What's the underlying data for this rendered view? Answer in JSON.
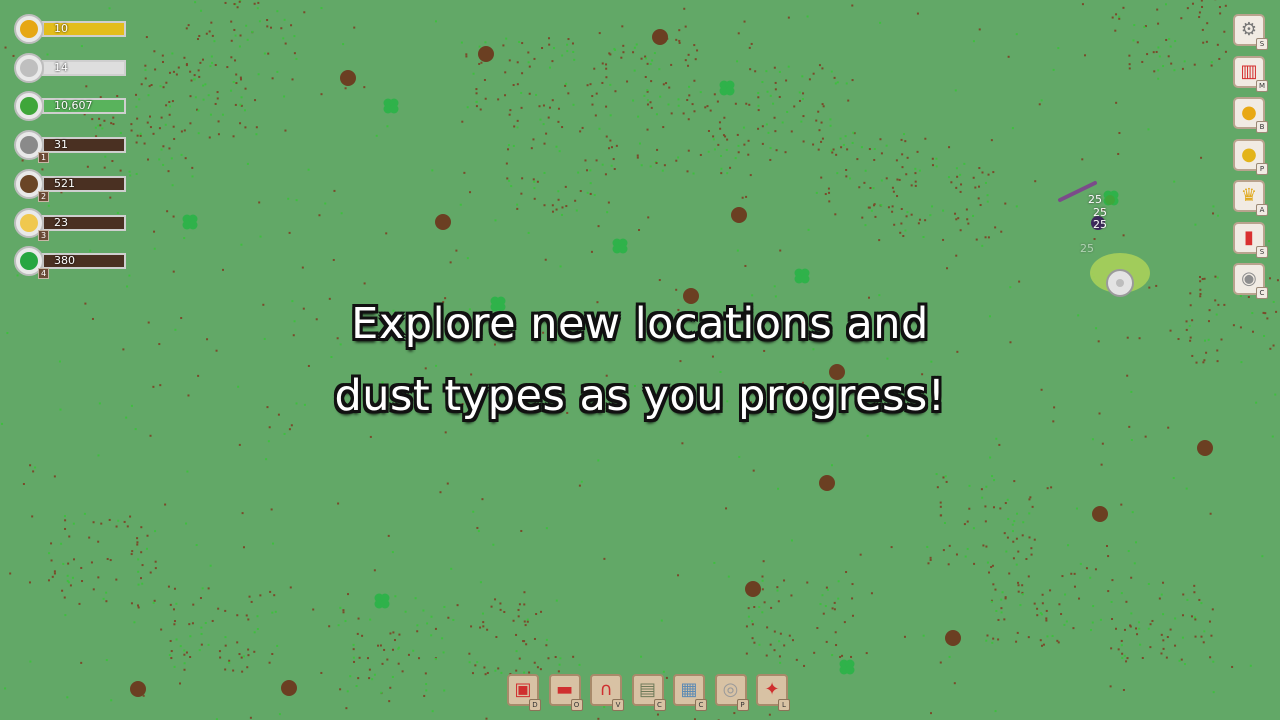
{
  "resources": [
    {
      "name": "gold-coins",
      "value": "10",
      "key": "",
      "fill_ratio": 1.0,
      "fill_color": "#e3bd1c",
      "icon_color": "#e6a714"
    },
    {
      "name": "silver-coins",
      "value": "14",
      "key": "",
      "fill_ratio": 1.0,
      "fill_color": "#dedede",
      "icon_color": "#bfbfbf"
    },
    {
      "name": "cash",
      "value": "10,607",
      "key": "",
      "fill_ratio": 1.0,
      "fill_color": "#59b35c",
      "icon_color": "#3fa63a"
    },
    {
      "name": "gray-dust",
      "value": "31",
      "key": "1",
      "fill_ratio": 0.0,
      "fill_color": "#4a3022",
      "icon_color": "#8a8a8a"
    },
    {
      "name": "brown-dust",
      "value": "521",
      "key": "2",
      "fill_ratio": 0.05,
      "fill_color": "#4a3022",
      "icon_color": "#6a4526"
    },
    {
      "name": "gold-dust",
      "value": "23",
      "key": "3",
      "fill_ratio": 0.0,
      "fill_color": "#4a3022",
      "icon_color": "#f0c84e"
    },
    {
      "name": "clover",
      "value": "380",
      "key": "4",
      "fill_ratio": 0.0,
      "fill_color": "#4a3022",
      "icon_color": "#27a640"
    }
  ],
  "menu": [
    {
      "name": "settings-button",
      "icon": "gear-icon",
      "glyph": "⚙",
      "color": "#777777",
      "key": "S"
    },
    {
      "name": "shop-button",
      "icon": "shop-icon",
      "glyph": "▥",
      "color": "#d42b2b",
      "key": "M"
    },
    {
      "name": "boosts-button",
      "icon": "lightbulb-icon",
      "glyph": "●",
      "color": "#e8a813",
      "key": "B"
    },
    {
      "name": "coins-button",
      "icon": "coin-icon",
      "glyph": "●",
      "color": "#e3b419",
      "key": "P"
    },
    {
      "name": "achievements-button",
      "icon": "trophy-icon",
      "glyph": "♛",
      "color": "#e0a91d",
      "key": "A"
    },
    {
      "name": "stats-button",
      "icon": "bar-chart-icon",
      "glyph": "▮",
      "color": "#d93030",
      "key": "S"
    },
    {
      "name": "collection-button",
      "icon": "disc-icon",
      "glyph": "◉",
      "color": "#8e8e8e",
      "key": "C"
    }
  ],
  "toolbar": [
    {
      "name": "vacuum-button",
      "icon": "vacuum-icon",
      "glyph": "▣",
      "color": "#cf2f2f",
      "key": "D"
    },
    {
      "name": "vehicle-button",
      "icon": "vehicle-icon",
      "glyph": "▬",
      "color": "#cf2f2f",
      "key": "O"
    },
    {
      "name": "nozzle-button",
      "icon": "nozzle-icon",
      "glyph": "∩",
      "color": "#cf2f2f",
      "key": "V"
    },
    {
      "name": "map-button",
      "icon": "map-icon",
      "glyph": "▤",
      "color": "#6f7b5a",
      "key": "C"
    },
    {
      "name": "bag-button",
      "icon": "bag-icon",
      "glyph": "▦",
      "color": "#5e8bb3",
      "key": "C"
    },
    {
      "name": "disc-button",
      "icon": "disc-icon",
      "glyph": "◎",
      "color": "#9a9a9a",
      "key": "P"
    },
    {
      "name": "location-button",
      "icon": "location-pin-icon",
      "glyph": "✦",
      "color": "#cf2f2f",
      "key": "L"
    }
  ],
  "banner": {
    "line1": "Explore new locations and",
    "line2": "dust types as you progress!"
  },
  "damage_numbers": [
    "25",
    "25",
    "25",
    "25"
  ]
}
